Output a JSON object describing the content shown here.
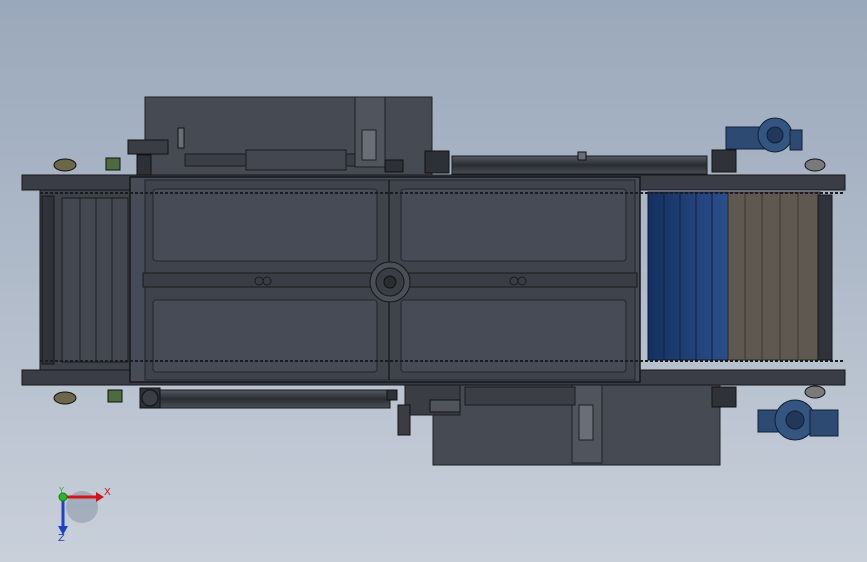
{
  "triad": {
    "x_label": "X",
    "y_label": "Y",
    "z_label": "Z",
    "x_color": "#d0161b",
    "y_color": "#2bb52b",
    "z_color": "#1f3fc8"
  },
  "colors": {
    "background_top": "#9aa8bb",
    "background_bottom": "#c9d0da",
    "frame": "#3a3d46",
    "panel": "#474b55",
    "belt_dark": "#3e4148",
    "belt_blue": "#1f3d7a",
    "belt_brown": "#5e5850",
    "motor_blue": "#2c4a72"
  }
}
